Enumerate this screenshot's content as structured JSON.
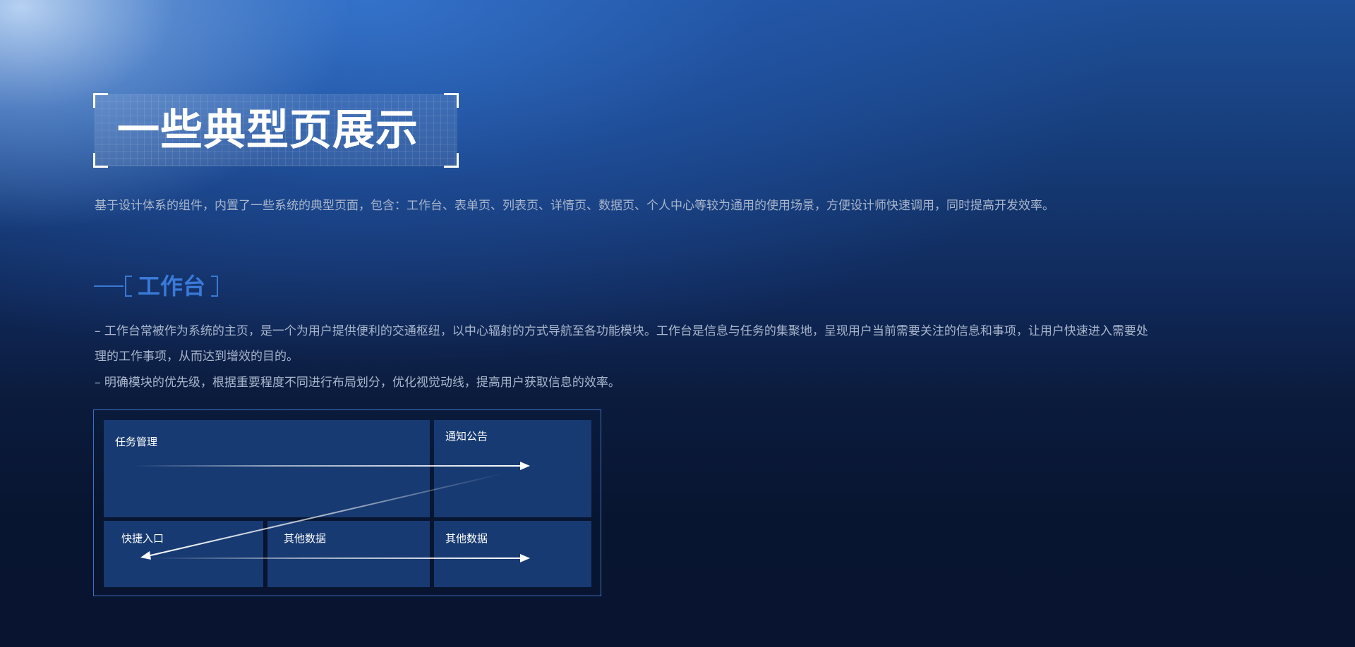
{
  "title": "一些典型页展示",
  "intro": "基于设计体系的组件，内置了一些系统的典型页面，包含：工作台、表单页、列表页、详情页、数据页、个人中心等较为通用的使用场景，方便设计师快速调用，同时提高开发效率。",
  "section": {
    "title": "工作台",
    "desc_line1": "– 工作台常被作为系统的主页，是一个为用户提供便利的交通枢纽，以中心辐射的方式导航至各功能模块。工作台是信息与任务的集聚地，呈现用户当前需要关注的信息和事项，让用户快速进入需要处",
    "desc_line2": "理的工作事项，从而达到增效的目的。",
    "desc_line3": " – 明确模块的优先级，根据重要程度不同进行布局划分，优化视觉动线，提高用户获取信息的效率。"
  },
  "diagram": {
    "task_management": "任务管理",
    "notice": "通知公告",
    "quick_entry": "快捷入口",
    "other_data_1": "其他数据",
    "other_data_2": "其他数据"
  },
  "colors": {
    "accent": "#3a7ad8",
    "cell_bg": "#173a72",
    "text_muted": "#a9b6cc"
  }
}
